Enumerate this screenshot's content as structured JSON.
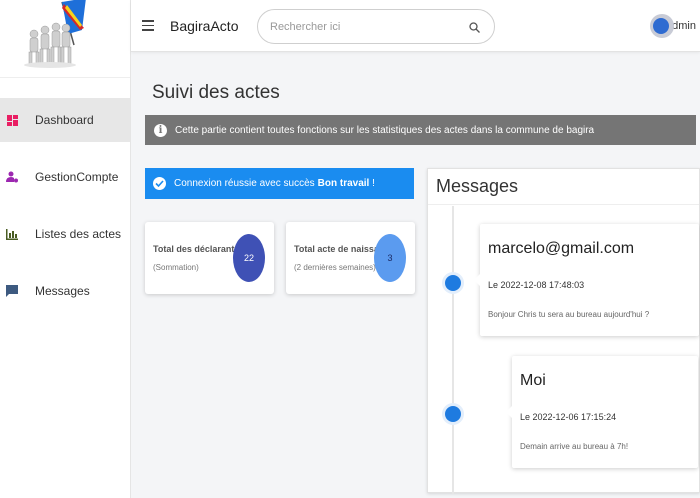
{
  "header": {
    "brand": "BagiraActo",
    "search_placeholder": "Rechercher ici",
    "user_name": "admin"
  },
  "sidebar": {
    "items": [
      {
        "label": "Dashboard",
        "icon": "dashboard-icon",
        "active": true
      },
      {
        "label": "GestionCompte",
        "icon": "account-manage-icon",
        "active": false
      },
      {
        "label": "Listes des actes",
        "icon": "bar-chart-icon",
        "active": false
      },
      {
        "label": "Messages",
        "icon": "message-icon",
        "active": false
      }
    ]
  },
  "main": {
    "title": "Suivi des actes",
    "info": "Cette partie contient toutes fonctions sur les statistiques des actes dans la commune de bagira",
    "success_text": "Connexion réussie avec succès",
    "success_bold": "Bon travail",
    "success_end": " !",
    "stats": [
      {
        "title": "Total des déclarants",
        "subtitle": "(Sommation)",
        "value": "22"
      },
      {
        "title": "Total acte de naissance",
        "subtitle": "(2 dernières semaines)",
        "value": "3"
      }
    ]
  },
  "messages": {
    "title": "Messages",
    "items": [
      {
        "from": "marcelo@gmail.com",
        "date": "Le 2022-12-08 17:48:03",
        "text": "Bonjour Chris tu sera au bureau aujourd'hui ?"
      },
      {
        "from": "Moi",
        "date": "Le 2022-12-06 17:15:24",
        "text": "Demain arrive au bureau à 7h!"
      }
    ]
  },
  "colors": {
    "accent": "#1a8cf0",
    "info_bg": "#757575",
    "stat1_circle": "#3f51b5",
    "stat2_circle": "#5b9bef",
    "timeline_dot": "#1e7be0",
    "dashboard_icon": "#e91e63",
    "account_icon": "#9c27b0",
    "chart_icon": "#4a5d23",
    "message_icon": "#3d5a80"
  }
}
